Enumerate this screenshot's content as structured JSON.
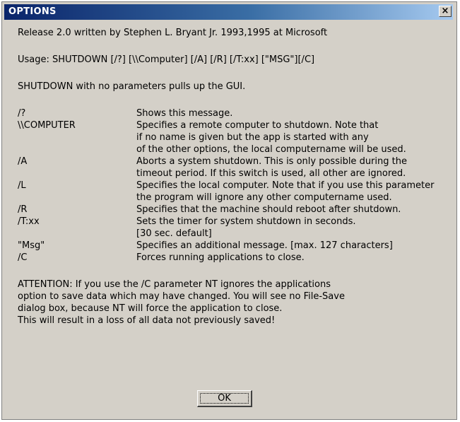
{
  "window": {
    "title": "OPTIONS",
    "close_icon": "×"
  },
  "intro": {
    "release": "Release 2.0 written by Stephen L. Bryant Jr. 1993,1995 at Microsoft",
    "usage": "Usage: SHUTDOWN [/?] [\\\\Computer] [/A] [/R] [/T:xx] [\"MSG\"][/C]",
    "gui": "SHUTDOWN with no parameters pulls up the GUI."
  },
  "options": [
    {
      "flag": "/?",
      "lines": [
        "Shows this message."
      ]
    },
    {
      "flag": "\\\\COMPUTER",
      "lines": [
        "Specifies a remote computer to shutdown. Note that",
        "if no name is given but the app is started with any",
        "of the other options, the local computername will be used."
      ]
    },
    {
      "flag": "/A",
      "lines": [
        "Aborts a system shutdown. This is only possible during the",
        "timeout period. If this switch is used, all other are ignored."
      ]
    },
    {
      "flag": "/L",
      "lines": [
        "Specifies the local computer.  Note that if you use this parameter",
        "the program will ignore any other computername used."
      ]
    },
    {
      "flag": "/R",
      "lines": [
        "Specifies that the machine should reboot after shutdown."
      ]
    },
    {
      "flag": "/T:xx",
      "lines": [
        "Sets the timer for system shutdown in seconds.",
        "[30 sec. default]"
      ]
    },
    {
      "flag": "\"Msg\"",
      "lines": [
        "Specifies an additional message. [max. 127 characters]"
      ]
    },
    {
      "flag": "/C",
      "lines": [
        "Forces running applications to close."
      ]
    }
  ],
  "attention": [
    "ATTENTION: If you use the /C parameter NT ignores the applications",
    "option to save data which may have changed. You will see no File-Save",
    "dialog box, because NT will force the application to close.",
    "This will result in a loss of all data not previously saved!"
  ],
  "ok_button": {
    "label": "OK"
  }
}
